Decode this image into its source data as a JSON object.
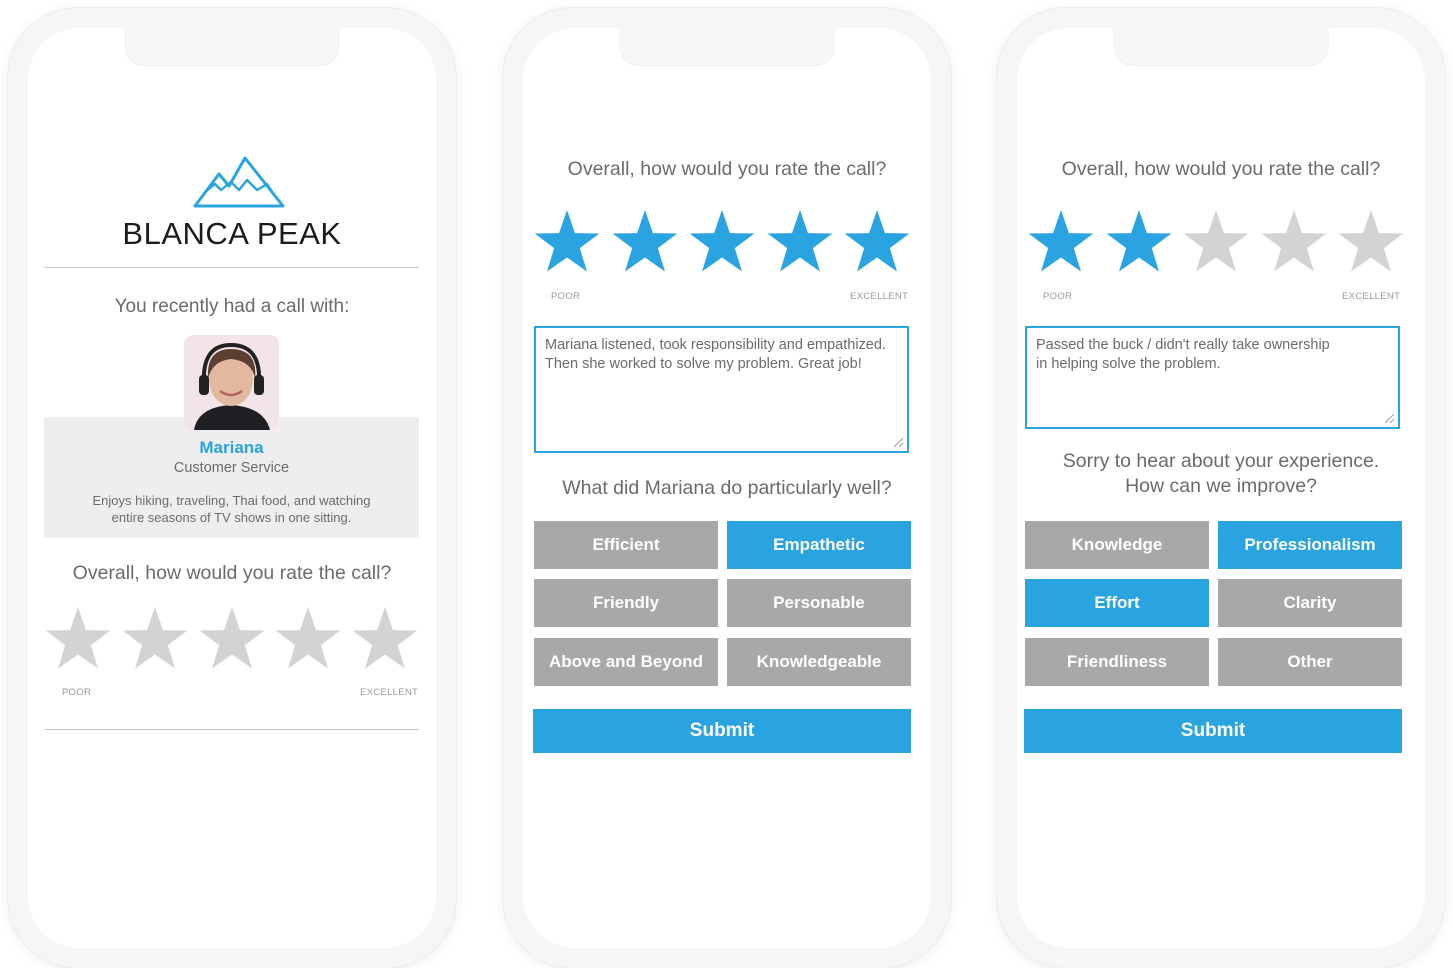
{
  "colors": {
    "accent": "#2aa4e0",
    "star_off": "#d3d3d3",
    "chip_off": "#a6a8aa",
    "profile_bg": "#eeeef0"
  },
  "screen1": {
    "brand": "BLANCA PEAK",
    "logo_icon": "mountain-logo-icon",
    "intro": "You recently had a call with:",
    "agent": {
      "name": "Mariana",
      "role": "Customer Service",
      "bio_line1": "Enjoys hiking, traveling, Thai food, and watching",
      "bio_line2": "entire seasons of TV shows in one sitting."
    },
    "question": "Overall, how would you rate the call?",
    "rating": 0,
    "scale_low": "POOR",
    "scale_high": "EXCELLENT"
  },
  "screen2": {
    "question": "Overall, how would you rate the call?",
    "rating": 5,
    "scale_low": "POOR",
    "scale_high": "EXCELLENT",
    "comment_line1": "Mariana listened, took responsibility and empathized.",
    "comment_line2": "Then she worked to solve my problem. Great job!",
    "followup": "What did Mariana do particularly well?",
    "options": [
      {
        "label": "Efficient",
        "selected": false
      },
      {
        "label": "Empathetic",
        "selected": true
      },
      {
        "label": "Friendly",
        "selected": false
      },
      {
        "label": "Personable",
        "selected": false
      },
      {
        "label": "Above and Beyond",
        "selected": false
      },
      {
        "label": "Knowledgeable",
        "selected": false
      }
    ],
    "submit": "Submit"
  },
  "screen3": {
    "question": "Overall, how would you rate the call?",
    "rating": 2,
    "scale_low": "POOR",
    "scale_high": "EXCELLENT",
    "comment_line1": "Passed the buck / didn't really take ownership",
    "comment_line2": "in helping solve the problem.",
    "followup_line1": "Sorry to hear about your experience.",
    "followup_line2": "How can we improve?",
    "options": [
      {
        "label": "Knowledge",
        "selected": false
      },
      {
        "label": "Professionalism",
        "selected": true
      },
      {
        "label": "Effort",
        "selected": true
      },
      {
        "label": "Clarity",
        "selected": false
      },
      {
        "label": "Friendliness",
        "selected": false
      },
      {
        "label": "Other",
        "selected": false
      }
    ],
    "submit": "Submit"
  }
}
